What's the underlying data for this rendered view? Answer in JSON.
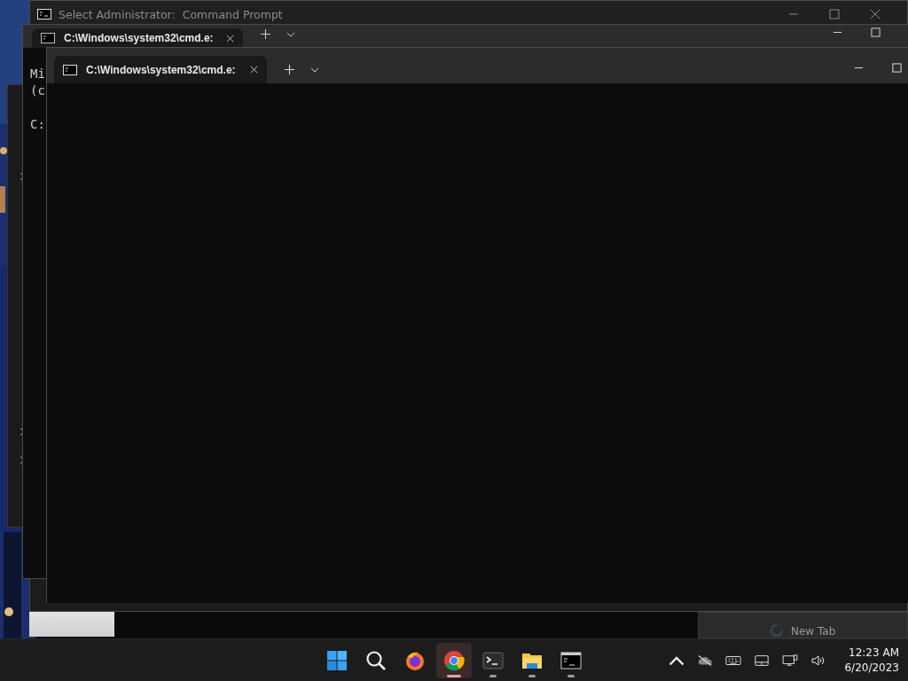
{
  "back_window": {
    "title": "Select Administrator:  Command Prompt"
  },
  "middle_window": {
    "tab": {
      "label": "C:\\Windows\\system32\\cmd.e:",
      "selected": true
    },
    "console_lines": [
      "Mi",
      "(c",
      "C:"
    ]
  },
  "front_window": {
    "tab": {
      "label": "C:\\Windows\\system32\\cmd.e:",
      "selected": true
    }
  },
  "taskbar_preview": {
    "title": "New Tab"
  },
  "taskbar": {
    "apps": [
      {
        "kind": "start",
        "running": false,
        "selected": false
      },
      {
        "kind": "search",
        "running": false,
        "selected": false
      },
      {
        "kind": "firefox",
        "running": false,
        "selected": false
      },
      {
        "kind": "chrome",
        "running": true,
        "selected": true
      },
      {
        "kind": "terminal",
        "running": true,
        "selected": false
      },
      {
        "kind": "explorer",
        "running": true,
        "selected": false
      },
      {
        "kind": "cmd",
        "running": true,
        "selected": false
      }
    ],
    "time": "12:23 AM",
    "date": "6/20/2023"
  }
}
